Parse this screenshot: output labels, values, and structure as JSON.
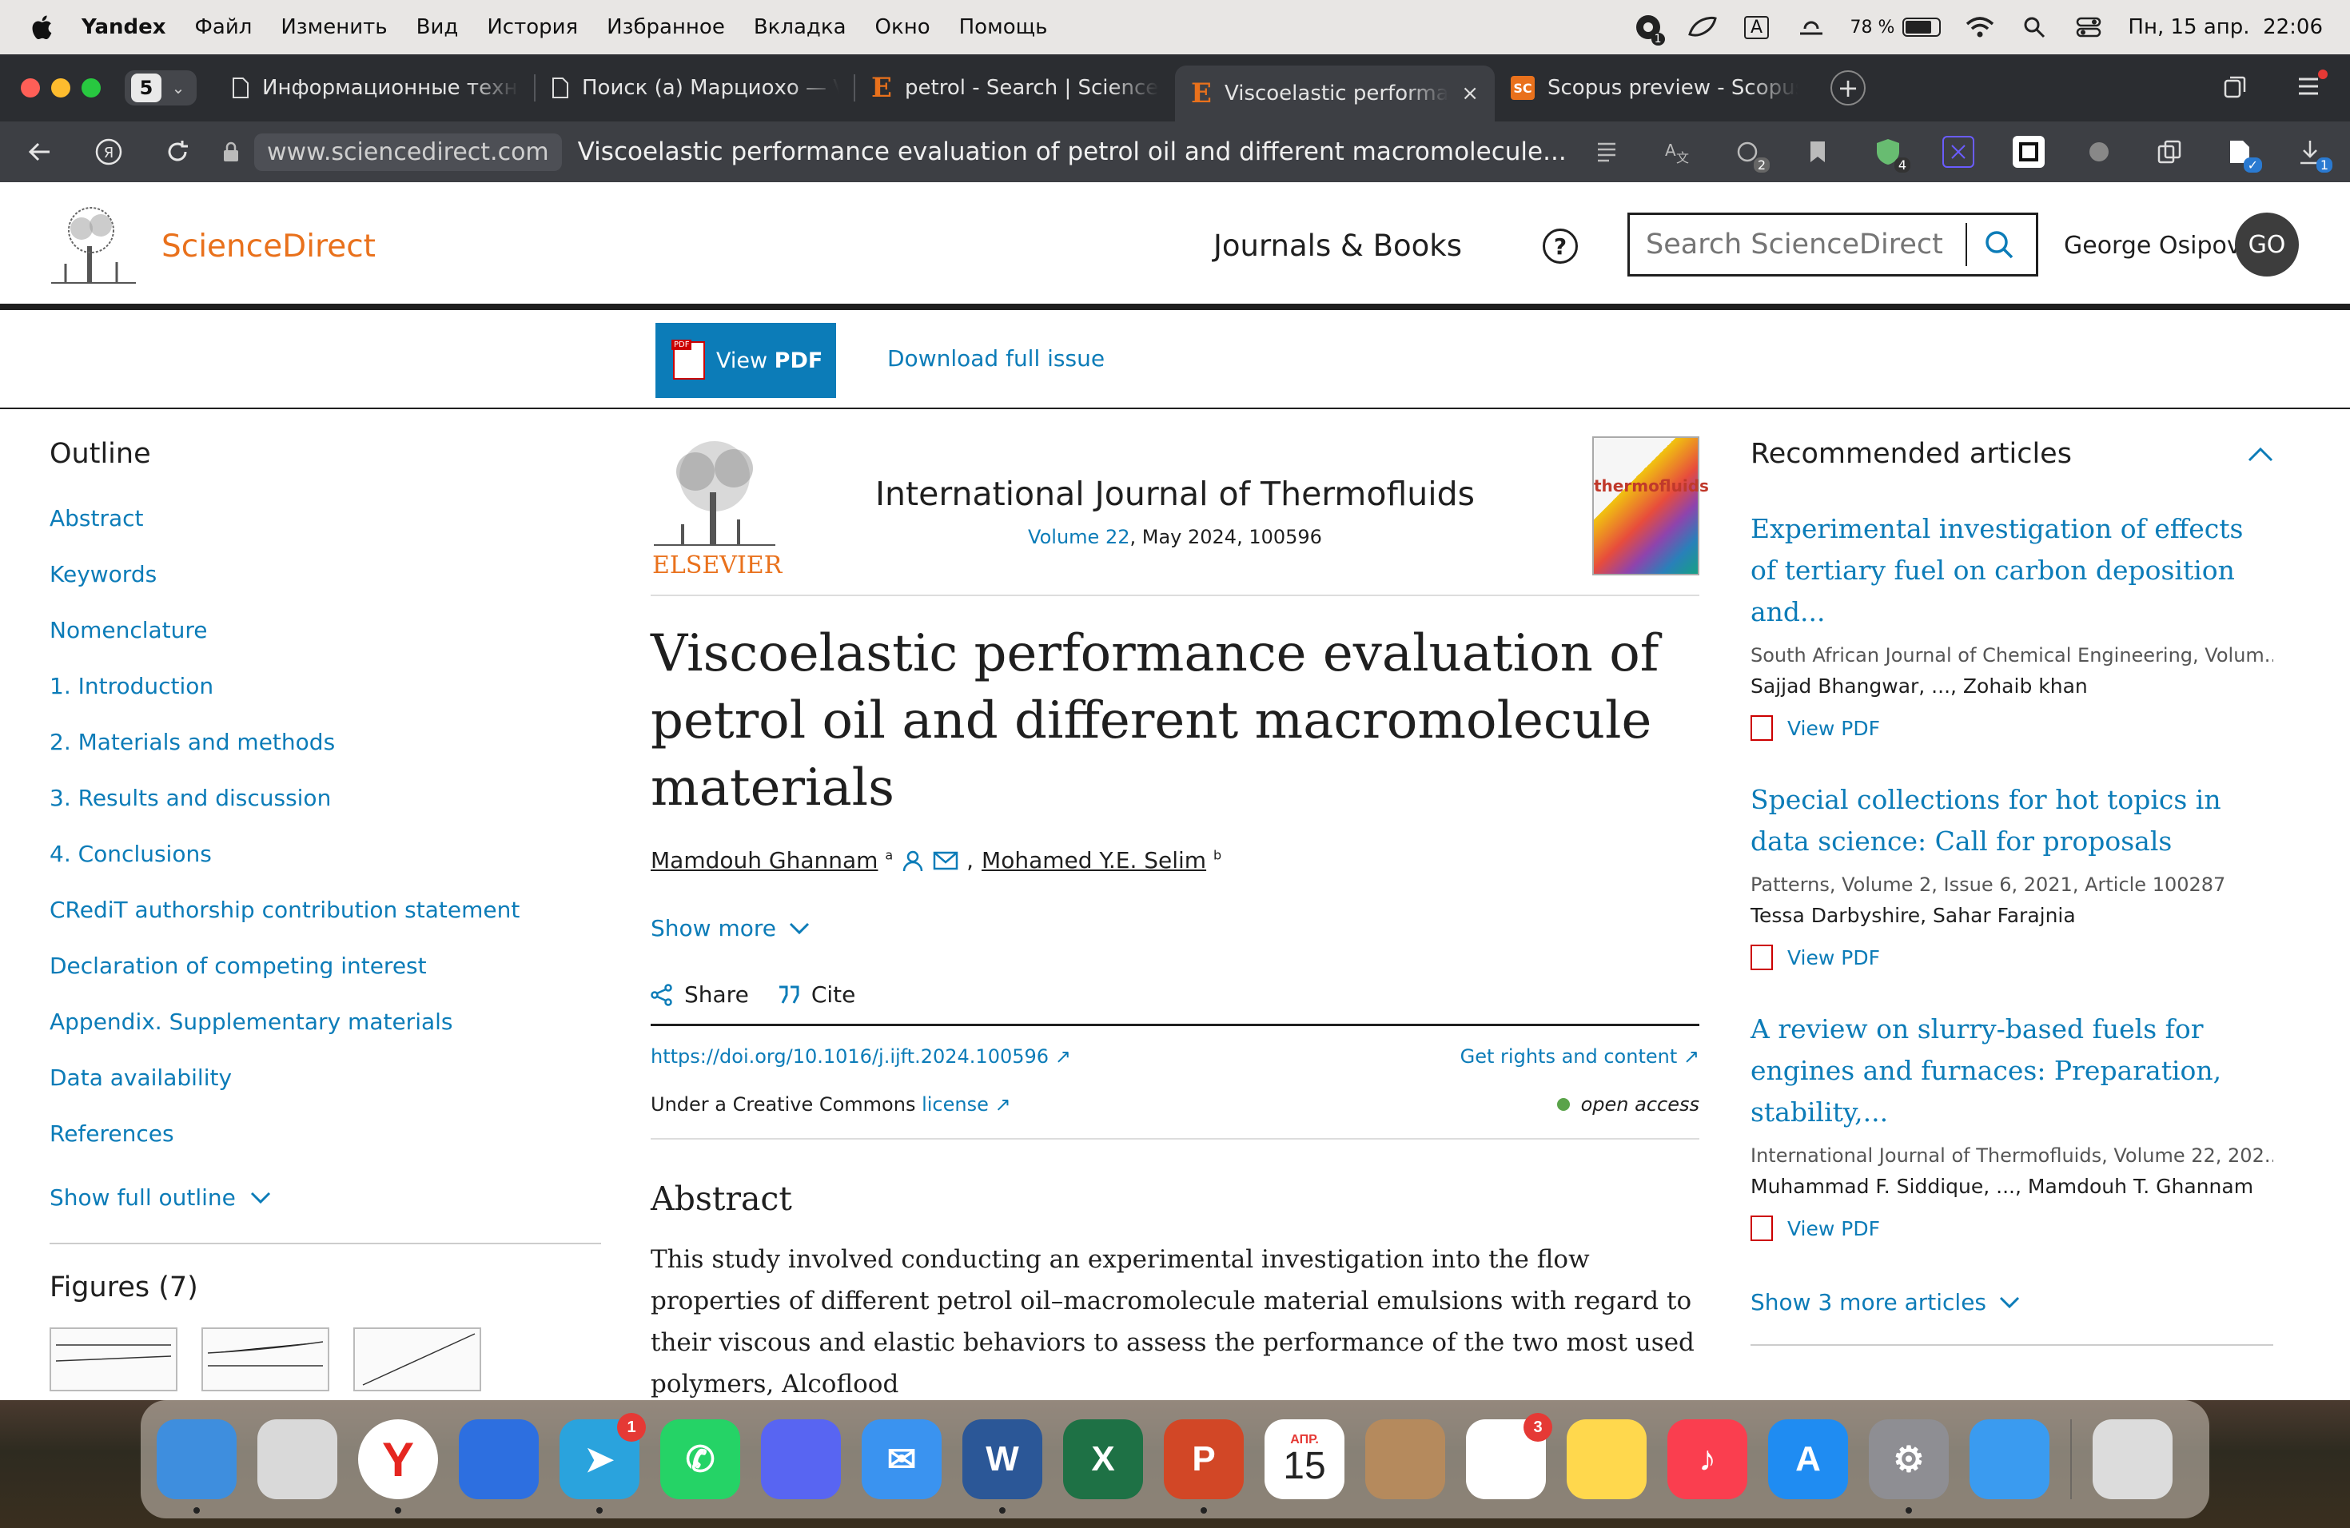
{
  "menubar": {
    "app": "Yandex",
    "items": [
      "Файл",
      "Изменить",
      "Вид",
      "История",
      "Избранное",
      "Вкладка",
      "Окно",
      "Помощь"
    ],
    "battery": "78 %",
    "datetime": "Пн, 15 апр.  22:06",
    "badge_count": "1",
    "input_indicator": "A"
  },
  "tabs": {
    "count": "5",
    "items": [
      {
        "title": "Информационные техно",
        "favicon": "document-icon"
      },
      {
        "title": "Поиск (а) Марциохо — V",
        "favicon": "document-icon"
      },
      {
        "title": "petrol - Search | ScienceD",
        "favicon": "elsevier-icon"
      },
      {
        "title": "Viscoelastic performan",
        "favicon": "elsevier-icon",
        "active": true
      },
      {
        "title": "Scopus preview - Scopus",
        "favicon": "scopus-icon"
      }
    ],
    "scopus_fav": "SC"
  },
  "address": {
    "url": "www.sciencedirect.com",
    "title": "Viscoelastic performance evaluation of petrol oil and different macromolecule...",
    "ext_badges": [
      "2",
      "4",
      "1"
    ]
  },
  "site": {
    "name": "ScienceDirect",
    "journals_link": "Journals & Books",
    "help": "?",
    "search_placeholder": "Search ScienceDirect",
    "user_name": "George Osipov",
    "user_initials": "GO"
  },
  "toolbar": {
    "view_pdf_prefix": "View",
    "view_pdf_bold": "PDF",
    "download_issue": "Download full issue"
  },
  "outline": {
    "heading": "Outline",
    "items": [
      "Abstract",
      "Keywords",
      "Nomenclature",
      "1. Introduction",
      "2. Materials and methods",
      "3. Results and discussion",
      "4. Conclusions",
      "CRediT authorship contribution statement",
      "Declaration of competing interest",
      "Appendix. Supplementary materials",
      "Data availability",
      "References"
    ],
    "show_full": "Show full outline",
    "figures": "Figures (7)"
  },
  "article": {
    "publisher": "ELSEVIER",
    "journal": "International Journal of Thermofluids",
    "volume_link": "Volume 22",
    "volume_rest": ", May 2024, 100596",
    "cover_text": "thermofluids",
    "title": "Viscoelastic performance evaluation of petrol oil and different macromolecule materials",
    "author1": "Mamdouh Ghannam",
    "author1_sup": "a",
    "author2": "Mohamed Y.E. Selim",
    "author2_sup": "b",
    "author_sep": ",",
    "show_more": "Show more",
    "share": "Share",
    "cite": "Cite",
    "doi": "https://doi.org/10.1016/j.ijft.2024.100596",
    "rights": "Get rights and content",
    "cc_text": "Under a Creative Commons",
    "cc_link": "license",
    "open_access": "open access",
    "abstract_heading": "Abstract",
    "abstract_text": "This study involved conducting an experimental investigation into the flow properties of different petrol oil–macromolecule material emulsions with regard to their viscous and elastic behaviors to assess the performance of the two most used polymers, Alcoflood"
  },
  "recommended": {
    "heading": "Recommended articles",
    "items": [
      {
        "title": "Experimental investigation of effects of tertiary fuel on carbon deposition and...",
        "source": "South African Journal of Chemical Engineering, Volum...",
        "authors": "Sajjad Bhangwar, ..., Zohaib khan",
        "pdf": "View PDF"
      },
      {
        "title": "Special collections for hot topics in data science: Call for proposals",
        "source": "Patterns, Volume 2, Issue 6, 2021, Article 100287",
        "authors": "Tessa Darbyshire, Sahar Farajnia",
        "pdf": "View PDF"
      },
      {
        "title": "A review on slurry-based fuels for engines and furnaces: Preparation, stability,...",
        "source": "International Journal of Thermofluids, Volume 22, 202...",
        "authors": "Muhammad F. Siddique, ..., Mamdouh T. Ghannam",
        "pdf": "View PDF"
      }
    ],
    "show_more": "Show 3 more articles"
  },
  "dock": {
    "apps": [
      {
        "name": "finder",
        "color": "#3e8ede",
        "glyph": ""
      },
      {
        "name": "launchpad",
        "color": "#d9d9d9",
        "glyph": ""
      },
      {
        "name": "yandex-browser",
        "color": "#ffffff",
        "glyph": "Y"
      },
      {
        "name": "yandex-messenger",
        "color": "#2d6fe0",
        "glyph": ""
      },
      {
        "name": "telegram",
        "color": "#2aa3dd",
        "glyph": "➤",
        "badge": "1"
      },
      {
        "name": "whatsapp",
        "color": "#25d366",
        "glyph": "✆"
      },
      {
        "name": "discord",
        "color": "#5865f2",
        "glyph": ""
      },
      {
        "name": "mail",
        "color": "#3a93f0",
        "glyph": "✉"
      },
      {
        "name": "word",
        "color": "#2b5797",
        "glyph": "W"
      },
      {
        "name": "excel",
        "color": "#1e7145",
        "glyph": "X"
      },
      {
        "name": "powerpoint",
        "color": "#d24726",
        "glyph": "P"
      },
      {
        "name": "calendar",
        "color": "#ffffff",
        "glyph": "15",
        "month": "АПР."
      },
      {
        "name": "contacts",
        "color": "#b58a5d",
        "glyph": ""
      },
      {
        "name": "reminders",
        "color": "#ffffff",
        "glyph": "",
        "badge": "3"
      },
      {
        "name": "notes",
        "color": "#ffd84d",
        "glyph": ""
      },
      {
        "name": "music",
        "color": "#fa3e4f",
        "glyph": "♪"
      },
      {
        "name": "app-store",
        "color": "#1f8cf2",
        "glyph": "A"
      },
      {
        "name": "system-settings",
        "color": "#8e8e93",
        "glyph": "⚙"
      },
      {
        "name": "safari",
        "color": "#3a9bf0",
        "glyph": ""
      },
      {
        "name": "trash",
        "color": "#dcdcdc",
        "glyph": ""
      }
    ]
  },
  "colors": {
    "link": "#0c7cb8",
    "brand": "#e9711c",
    "tab_bg": "#2b2d31",
    "address_bg": "#3d3f44"
  }
}
